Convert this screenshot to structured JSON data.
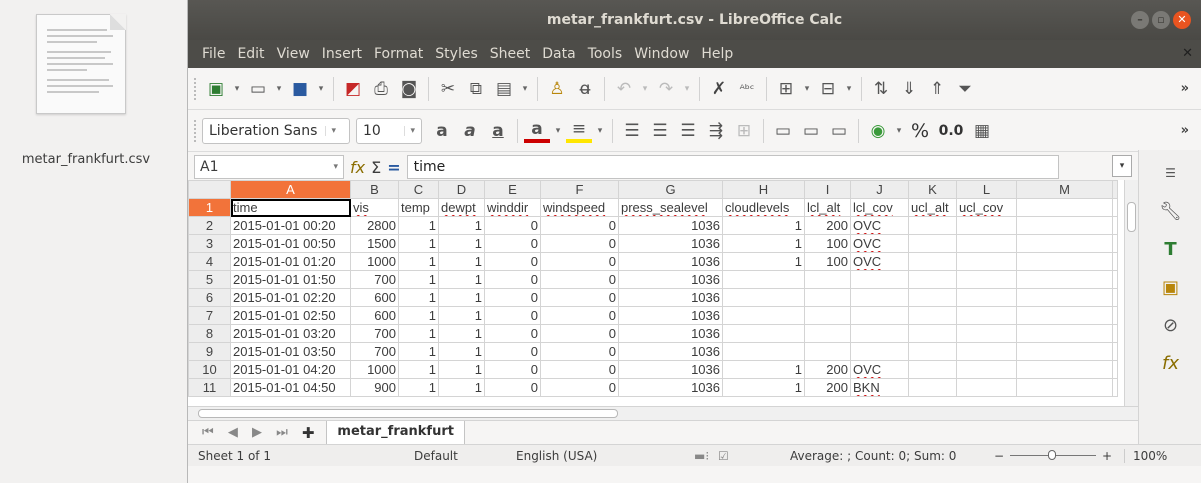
{
  "desktop": {
    "file_label": "metar_frankfurt.csv"
  },
  "window": {
    "title": "metar_frankfurt.csv - LibreOffice Calc"
  },
  "menu": [
    "File",
    "Edit",
    "View",
    "Insert",
    "Format",
    "Styles",
    "Sheet",
    "Data",
    "Tools",
    "Window",
    "Help"
  ],
  "format_toolbar": {
    "font_name": "Liberation Sans",
    "font_size": "10",
    "percent": "%",
    "decimal": "0.0"
  },
  "formula_bar": {
    "cell_ref": "A1",
    "content": "time"
  },
  "grid": {
    "columns": [
      "A",
      "B",
      "C",
      "D",
      "E",
      "F",
      "G",
      "H",
      "I",
      "J",
      "K",
      "L",
      "M"
    ],
    "rows": [
      [
        "1",
        [
          "time",
          "vis",
          "temp",
          "dewpt",
          "winddir",
          "windspeed",
          "press_sealevel",
          "cloudlevels",
          "lcl_alt",
          "lcl_cov",
          "ucl_alt",
          "ucl_cov",
          ""
        ]
      ],
      [
        "2",
        [
          "2015-01-01 00:20",
          "2800",
          "1",
          "1",
          "0",
          "0",
          "1036",
          "1",
          "200",
          "OVC",
          "",
          "",
          ""
        ]
      ],
      [
        "3",
        [
          "2015-01-01 00:50",
          "1500",
          "1",
          "1",
          "0",
          "0",
          "1036",
          "1",
          "100",
          "OVC",
          "",
          "",
          ""
        ]
      ],
      [
        "4",
        [
          "2015-01-01 01:20",
          "1000",
          "1",
          "1",
          "0",
          "0",
          "1036",
          "1",
          "100",
          "OVC",
          "",
          "",
          ""
        ]
      ],
      [
        "5",
        [
          "2015-01-01 01:50",
          "700",
          "1",
          "1",
          "0",
          "0",
          "1036",
          "",
          "",
          "",
          "",
          "",
          ""
        ]
      ],
      [
        "6",
        [
          "2015-01-01 02:20",
          "600",
          "1",
          "1",
          "0",
          "0",
          "1036",
          "",
          "",
          "",
          "",
          "",
          ""
        ]
      ],
      [
        "7",
        [
          "2015-01-01 02:50",
          "600",
          "1",
          "1",
          "0",
          "0",
          "1036",
          "",
          "",
          "",
          "",
          "",
          ""
        ]
      ],
      [
        "8",
        [
          "2015-01-01 03:20",
          "700",
          "1",
          "1",
          "0",
          "0",
          "1036",
          "",
          "",
          "",
          "",
          "",
          ""
        ]
      ],
      [
        "9",
        [
          "2015-01-01 03:50",
          "700",
          "1",
          "1",
          "0",
          "0",
          "1036",
          "",
          "",
          "",
          "",
          "",
          ""
        ]
      ],
      [
        "10",
        [
          "2015-01-01 04:20",
          "1000",
          "1",
          "1",
          "0",
          "0",
          "1036",
          "1",
          "200",
          "OVC",
          "",
          "",
          ""
        ]
      ],
      [
        "11",
        [
          "2015-01-01 04:50",
          "900",
          "1",
          "1",
          "0",
          "0",
          "1036",
          "1",
          "200",
          "BKN",
          "",
          "",
          ""
        ]
      ]
    ]
  },
  "sheet_tab": {
    "name": "metar_frankfurt"
  },
  "status": {
    "sheet": "Sheet 1 of 1",
    "style": "Default",
    "language": "English (USA)",
    "summary": "Average: ; Count: 0; Sum: 0",
    "zoom": "100%"
  },
  "colors": {
    "selected_header": "#f2733a",
    "title_bar": "#4d4c48",
    "close_button": "#e95420"
  }
}
